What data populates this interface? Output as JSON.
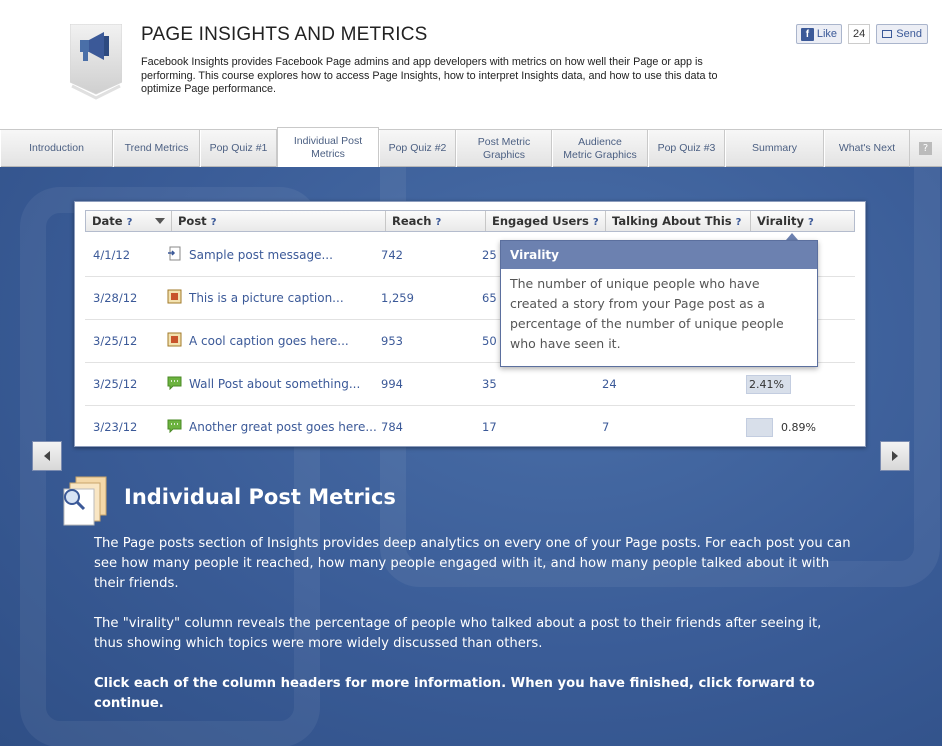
{
  "header": {
    "title": "PAGE INSIGHTS AND METRICS",
    "description": "Facebook Insights provides Facebook Page admins and app developers with metrics on how well their Page or app is performing. This course explores how to access Page Insights, how to interpret Insights data, and how to use this data to optimize Page performance.",
    "like_label": "Like",
    "like_count": "24",
    "send_label": "Send"
  },
  "tabs": [
    {
      "label": "Introduction"
    },
    {
      "label": "Trend Metrics"
    },
    {
      "label": "Pop Quiz #1"
    },
    {
      "label": "Individual Post Metrics"
    },
    {
      "label": "Pop Quiz #2"
    },
    {
      "label": "Post Metric Graphics"
    },
    {
      "label": "Audience Metric Graphics"
    },
    {
      "label": "Pop Quiz #3"
    },
    {
      "label": "Summary"
    },
    {
      "label": "What's Next"
    }
  ],
  "help_tab": "?",
  "table": {
    "headers": [
      "Date",
      "Post",
      "Reach",
      "Engaged Users",
      "Talking About This",
      "Virality"
    ],
    "help_mark": "?",
    "rows": [
      {
        "date": "4/1/12",
        "post": "Sample post message...",
        "reach": "742",
        "engaged": "25",
        "talking": "",
        "virality": "",
        "icon": "link-post-icon"
      },
      {
        "date": "3/28/12",
        "post": "This is a picture caption...",
        "reach": "1,259",
        "engaged": "65",
        "talking": "",
        "virality": "",
        "icon": "photo-post-icon"
      },
      {
        "date": "3/25/12",
        "post": "A cool caption goes here...",
        "reach": "953",
        "engaged": "50",
        "talking": "",
        "virality": "",
        "icon": "photo-post-icon"
      },
      {
        "date": "3/25/12",
        "post": "Wall Post about something...",
        "reach": "994",
        "engaged": "35",
        "talking": "24",
        "virality": "2.41%",
        "icon": "status-post-icon"
      },
      {
        "date": "3/23/12",
        "post": "Another great post goes here...",
        "reach": "784",
        "engaged": "17",
        "talking": "7",
        "virality": "0.89%",
        "icon": "status-post-icon"
      }
    ]
  },
  "tooltip": {
    "title": "Virality",
    "body": "The number of unique people who have created a story from your Page post as a percentage of the number of unique people who have seen it."
  },
  "section": {
    "title": "Individual Post Metrics",
    "para1": "The Page posts section of Insights provides deep analytics on every one of your Page posts. For each post you can see how many people it reached, how many people engaged with it, and how many people talked about it with their friends.",
    "para2": "The \"virality\" column reveals the percentage of people who talked about a post to their friends after seeing it, thus showing which topics were more widely discussed than others.",
    "para3": "Click each of the column headers for more information. When you have finished, click forward to continue."
  },
  "colors": {
    "fb_blue": "#3b5998",
    "bg_blue": "#3a5c97",
    "tip_header": "#6c81b0"
  }
}
